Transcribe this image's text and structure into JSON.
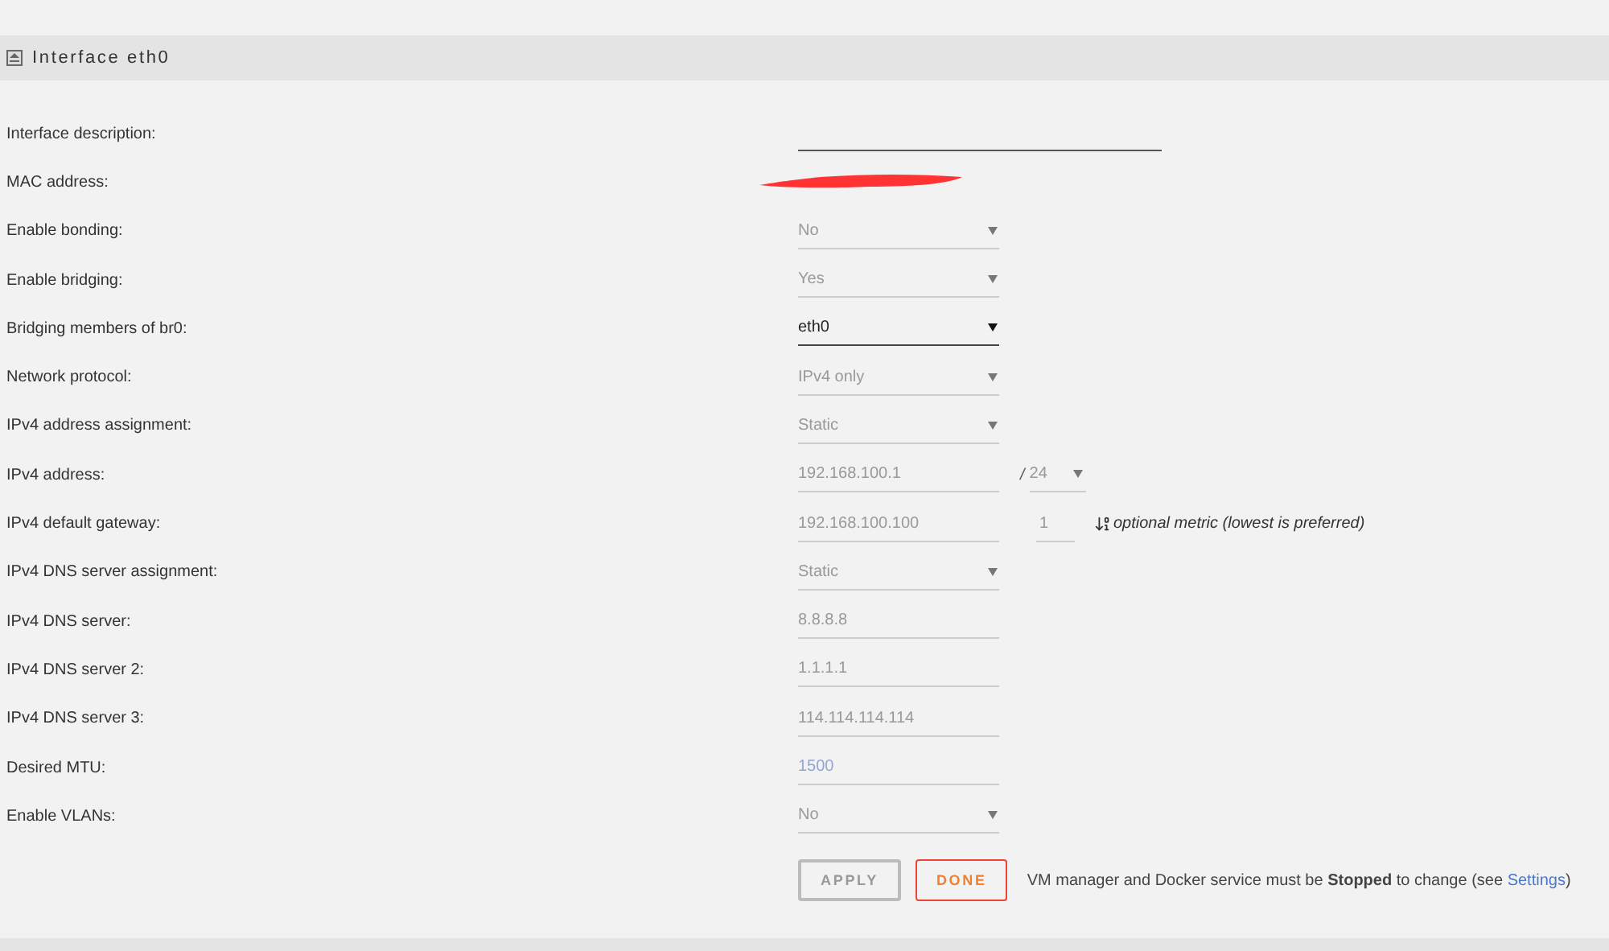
{
  "section": {
    "title": "Interface eth0"
  },
  "rows": [
    {
      "label": "Interface description:",
      "kind": "input",
      "disabled": false,
      "wide": true
    },
    {
      "label": "MAC address:",
      "kind": "redacted"
    },
    {
      "label": "Enable bonding:",
      "kind": "select",
      "value": "No",
      "disabled": true
    },
    {
      "label": "Enable bridging:",
      "kind": "select",
      "value": "Yes",
      "disabled": true
    },
    {
      "label": "Bridging members of br0:",
      "kind": "select",
      "value": "eth0",
      "disabled": false
    },
    {
      "label": "Network protocol:",
      "kind": "select",
      "value": "IPv4 only",
      "disabled": true
    },
    {
      "label": "IPv4 address assignment:",
      "kind": "select",
      "value": "Static",
      "disabled": true
    },
    {
      "label": "IPv4 address:",
      "kind": "input",
      "value": "192.168.100.1",
      "disabled": true,
      "extra": {
        "kind": "prefix",
        "separator": "/",
        "value": "24"
      }
    },
    {
      "label": "IPv4 default gateway:",
      "kind": "input",
      "value": "192.168.100.100",
      "disabled": true,
      "extra": {
        "kind": "metric",
        "value": "1",
        "hint": "optional metric (lowest is preferred)"
      }
    },
    {
      "label": "IPv4 DNS server assignment:",
      "kind": "select",
      "value": "Static",
      "disabled": true
    },
    {
      "label": "IPv4 DNS server:",
      "kind": "input",
      "value": "8.8.8.8",
      "disabled": true
    },
    {
      "label": "IPv4 DNS server 2:",
      "kind": "input",
      "value": "1.1.1.1",
      "disabled": true
    },
    {
      "label": "IPv4 DNS server 3:",
      "kind": "input",
      "value": "114.114.114.114",
      "disabled": true
    },
    {
      "label": "Desired MTU:",
      "kind": "input",
      "placeholder": "1500",
      "disabled": true
    },
    {
      "label": "Enable VLANs:",
      "kind": "select",
      "value": "No",
      "disabled": true
    }
  ],
  "buttons": [
    {
      "label": "APPLY",
      "disabled": true
    },
    {
      "label": "DONE",
      "disabled": false
    }
  ],
  "note": {
    "before": "VM manager and Docker service must be **Stopped** to change (see ",
    "link": "Settings",
    "after": ")"
  }
}
